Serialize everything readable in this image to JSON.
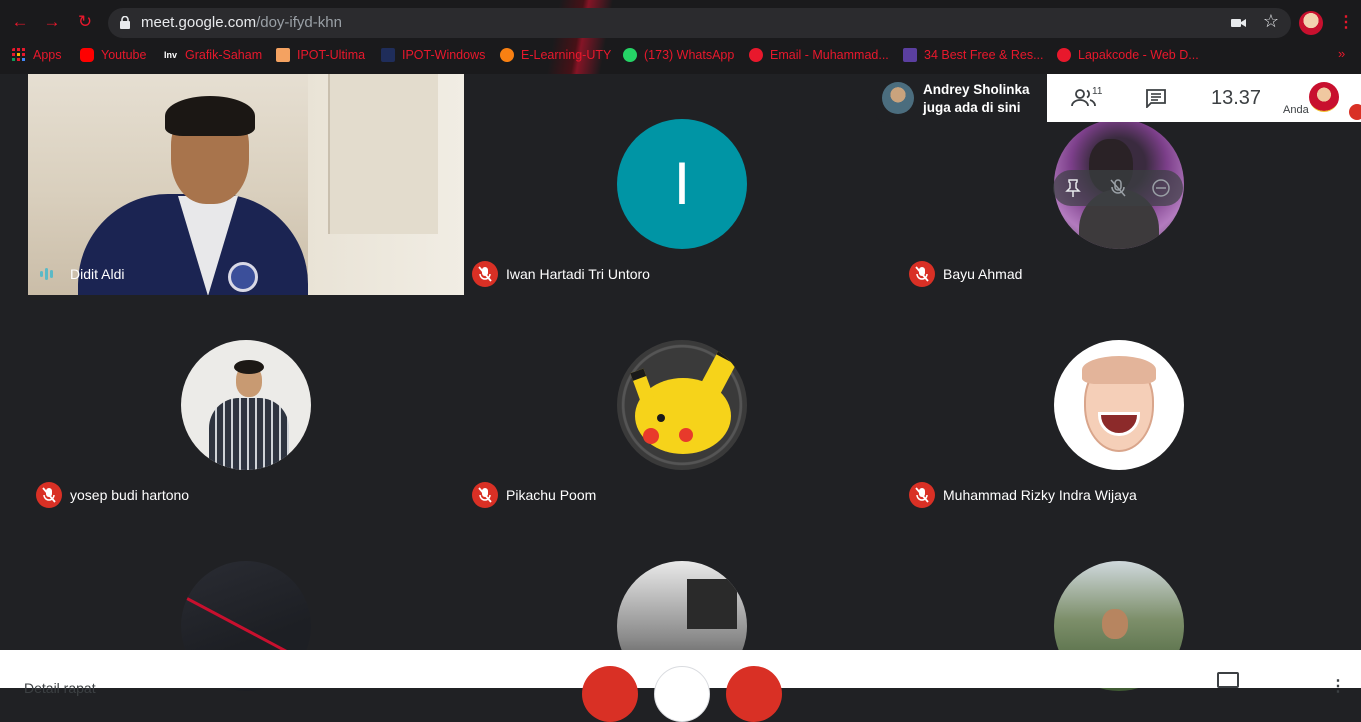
{
  "browser": {
    "url_host": "meet.google.com",
    "url_path": "/doy-ifyd-khn",
    "bookmarks": [
      {
        "label": "Apps",
        "icon": "apps-grid-icon",
        "color": "#e8182c"
      },
      {
        "label": "Youtube",
        "icon": "youtube-icon",
        "color": "#ff0000"
      },
      {
        "label": "Grafik-Saham",
        "icon": "investing-icon",
        "color": "#ffffff"
      },
      {
        "label": "IPOT-Ultima",
        "icon": "ipot-icon",
        "color": "#f4a261"
      },
      {
        "label": "IPOT-Windows",
        "icon": "ipot-windows-icon",
        "color": "#1a73e8"
      },
      {
        "label": "E-Learning-UTY",
        "icon": "moodle-icon",
        "color": "#f98012"
      },
      {
        "label": "(173) WhatsApp",
        "icon": "whatsapp-icon",
        "color": "#25d366"
      },
      {
        "label": "Email - Muhammad...",
        "icon": "email-icon",
        "color": "#e8182c"
      },
      {
        "label": "34 Best Free & Res...",
        "icon": "colorlib-icon",
        "color": "#5b3fa0"
      },
      {
        "label": "Lapakcode - Web D...",
        "icon": "lapakcode-icon",
        "color": "#e8182c"
      }
    ],
    "more_bookmarks": "»"
  },
  "meet": {
    "notification": {
      "line1": "Andrey Sholinka",
      "line2": "juga ada di sini"
    },
    "participants_count": "11",
    "time": "13.37",
    "self_label": "Anda",
    "tiles": [
      {
        "name": "Didit Aldi",
        "type": "video",
        "muted": false
      },
      {
        "name": "Iwan Hartadi Tri Untoro",
        "type": "letter",
        "letter": "I",
        "muted": true
      },
      {
        "name": "Bayu Ahmad",
        "type": "photo",
        "muted": true
      },
      {
        "name": "yosep budi hartono",
        "type": "photo",
        "muted": true
      },
      {
        "name": "Pikachu Poom",
        "type": "photo",
        "muted": true
      },
      {
        "name": "Muhammad Rizky Indra Wijaya",
        "type": "photo",
        "muted": true
      }
    ],
    "bottom": {
      "details_label": "Detail rapat"
    }
  },
  "colors": {
    "accent_red": "#d93025",
    "avatar_teal": "#0095a5",
    "background": "#202124"
  }
}
